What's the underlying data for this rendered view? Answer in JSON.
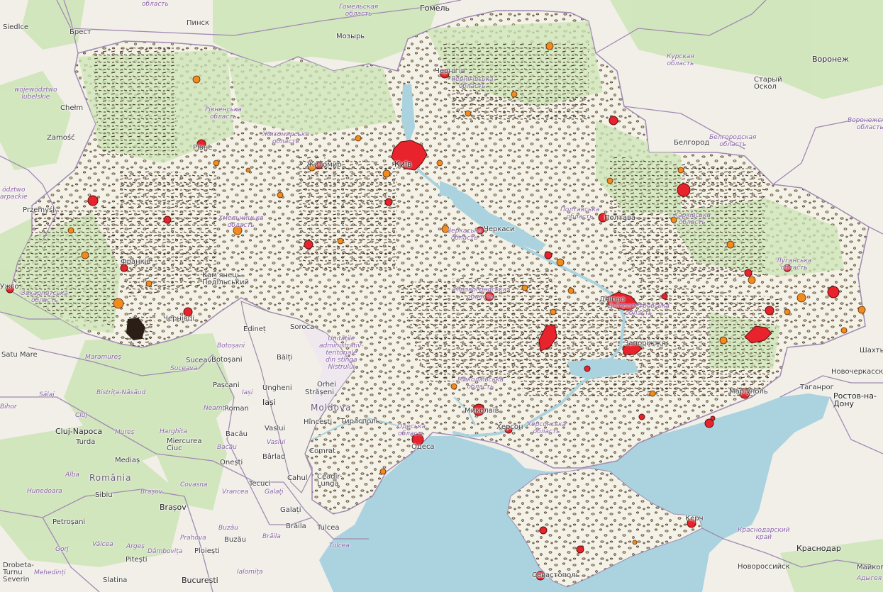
{
  "colors": {
    "land": "#f2efe9",
    "sea": "#aad3df",
    "forest": "#cde5b6",
    "ukraine_fill": "#f4f1e6",
    "urban_large": "#e8232b",
    "urban_medium": "#f28a1c",
    "settlement_outline": "#3a2a1e",
    "border": "#9b8aa6"
  },
  "labels": {
    "cities": [
      {
        "id": "gomel",
        "text": "Гомель"
      },
      {
        "id": "pinsk",
        "text": "Пинск"
      },
      {
        "id": "mozyr",
        "text": "Мозырь"
      },
      {
        "id": "brest",
        "text": "Брест"
      },
      {
        "id": "siedlce",
        "text": "Siedlce"
      },
      {
        "id": "chelm",
        "text": "Chełm"
      },
      {
        "id": "zamosc",
        "text": "Zamość"
      },
      {
        "id": "przemysl",
        "text": "Przemyśl"
      },
      {
        "id": "voronezh",
        "text": "Воронеж"
      },
      {
        "id": "stary_oskol",
        "text": "Старый\nОскол"
      },
      {
        "id": "belgorod",
        "text": "Белгород"
      },
      {
        "id": "chernihiv",
        "text": "Чернігів"
      },
      {
        "id": "kyiv",
        "text": "Київ"
      },
      {
        "id": "zhytomyr",
        "text": "Житомир"
      },
      {
        "id": "rivne",
        "text": "Рівне"
      },
      {
        "id": "poltava",
        "text": "Полтава"
      },
      {
        "id": "cherkasy",
        "text": "Черкаси"
      },
      {
        "id": "kamianets",
        "text": "Кам'янець-\nПодільський"
      },
      {
        "id": "ivano",
        "text": "Франків"
      },
      {
        "id": "chernivtsi",
        "text": "Чернівці"
      },
      {
        "id": "uzhhorod",
        "text": "Ужго"
      },
      {
        "id": "zaporizhzhia",
        "text": "Запоріжжя"
      },
      {
        "id": "dnipro",
        "text": "Дніпро"
      },
      {
        "id": "mariupol",
        "text": "Маріуполь"
      },
      {
        "id": "shakhty",
        "text": "Шахты"
      },
      {
        "id": "novocherkassk",
        "text": "Новочеркасск"
      },
      {
        "id": "taganrog",
        "text": "Таганрог"
      },
      {
        "id": "rostov",
        "text": "Ростов-на-\nДону"
      },
      {
        "id": "mykolaiv",
        "text": "Миколаїв"
      },
      {
        "id": "kherson",
        "text": "Херсон"
      },
      {
        "id": "odesa",
        "text": "Одеса"
      },
      {
        "id": "tiraspol",
        "text": "Тирасполь"
      },
      {
        "id": "kerch",
        "text": "Керч"
      },
      {
        "id": "sevastopol",
        "text": "Севастополь"
      },
      {
        "id": "krasnodar",
        "text": "Краснодар"
      },
      {
        "id": "novorossiysk",
        "text": "Новороссийск"
      },
      {
        "id": "maikop",
        "text": "Майкоп"
      },
      {
        "id": "edinet",
        "text": "Edineț"
      },
      {
        "id": "soroca",
        "text": "Soroca"
      },
      {
        "id": "balti",
        "text": "Bălți"
      },
      {
        "id": "ungheni",
        "text": "Ungheni"
      },
      {
        "id": "orhei",
        "text": "Orhei"
      },
      {
        "id": "straseni",
        "text": "Strășeni"
      },
      {
        "id": "iasi",
        "text": "Iași"
      },
      {
        "id": "hincesti",
        "text": "Hîncești"
      },
      {
        "id": "comrat",
        "text": "Comrat"
      },
      {
        "id": "cahul",
        "text": "Cahul"
      },
      {
        "id": "ceadir",
        "text": "Ceadîr-\nLunga"
      },
      {
        "id": "galati",
        "text": "Galați"
      },
      {
        "id": "braila",
        "text": "Brăila"
      },
      {
        "id": "tulcea",
        "text": "Tulcea"
      },
      {
        "id": "suceava",
        "text": "Suceava"
      },
      {
        "id": "botosani",
        "text": "Botoșani"
      },
      {
        "id": "pascani",
        "text": "Pașcani"
      },
      {
        "id": "roman",
        "text": "Roman"
      },
      {
        "id": "bacau",
        "text": "Bacău"
      },
      {
        "id": "vaslui",
        "text": "Vaslui"
      },
      {
        "id": "onesti",
        "text": "Onești"
      },
      {
        "id": "barlad",
        "text": "Bârlad"
      },
      {
        "id": "tecuci",
        "text": "Tecuci"
      },
      {
        "id": "cluj",
        "text": "Cluj-Napoca"
      },
      {
        "id": "turda",
        "text": "Turda"
      },
      {
        "id": "medias",
        "text": "Mediaș"
      },
      {
        "id": "sibiu",
        "text": "Sibiu"
      },
      {
        "id": "brasov",
        "text": "Brașov"
      },
      {
        "id": "miercurea",
        "text": "Miercurea\nCiuc"
      },
      {
        "id": "petrosani",
        "text": "Petroșani"
      },
      {
        "id": "pitesti",
        "text": "Pitești"
      },
      {
        "id": "ploiesti",
        "text": "Ploiești"
      },
      {
        "id": "buzau",
        "text": "Buzău"
      },
      {
        "id": "bucuresti",
        "text": "București"
      },
      {
        "id": "slatina",
        "text": "Slatina"
      },
      {
        "id": "drobeta",
        "text": "Drobeta-\nTurnu\nSeverin"
      },
      {
        "id": "satu_mare",
        "text": "Satu Mare"
      }
    ],
    "regions": [
      {
        "id": "gomel_obl",
        "text": "Гомельская\nобласть"
      },
      {
        "id": "brest_obl",
        "text": "область"
      },
      {
        "id": "kursk_obl",
        "text": "Курская\nобласть"
      },
      {
        "id": "belgorod_obl",
        "text": "Белгородская\nобласть"
      },
      {
        "id": "voronezh_obl",
        "text": "Воронежская\nобласть"
      },
      {
        "id": "lubelskie",
        "text": "województwo\nlubelskie"
      },
      {
        "id": "podkarpackie",
        "text": "ództwo\narpackie"
      },
      {
        "id": "rivne_obl",
        "text": "Рівненська\nобласть"
      },
      {
        "id": "zhytomyr_obl",
        "text": "Житомирська\nобласть"
      },
      {
        "id": "chernihiv_obl",
        "text": "Чернігівська\nобласть"
      },
      {
        "id": "poltava_obl",
        "text": "Полтавська\nобласть"
      },
      {
        "id": "cherkasy_obl",
        "text": "Черкаська\nобласть"
      },
      {
        "id": "khmelnytskyi_obl",
        "text": "Хмельницька\nобласть"
      },
      {
        "id": "kharkiv_obl",
        "text": "Харківська\nобласть"
      },
      {
        "id": "luhansk_obl",
        "text": "Луганська\nобласть"
      },
      {
        "id": "kirovohrad_obl",
        "text": "Кіровоградська\nобласть"
      },
      {
        "id": "dnipro_obl",
        "text": "Дніпропетровська\nобласть"
      },
      {
        "id": "mykolaiv_obl",
        "text": "Миколаївська\nобласть"
      },
      {
        "id": "odesa_obl",
        "text": "Одеська\nобласть"
      },
      {
        "id": "kherson_obl",
        "text": "Херсонська\nобласть"
      },
      {
        "id": "zakarpattia_obl",
        "text": "Закарпатська\nобласть"
      },
      {
        "id": "transnistria",
        "text": "Unitățile\nadministrativ-\nteritoriale\ndin stînga\nNistrului"
      },
      {
        "id": "krasnodar_krai",
        "text": "Краснодарский\nкрай"
      },
      {
        "id": "adygea",
        "text": "Адыгея"
      },
      {
        "id": "maramures",
        "text": "Maramureș"
      },
      {
        "id": "botosani_j",
        "text": "Botoșani"
      },
      {
        "id": "suceava_j",
        "text": "Suceava"
      },
      {
        "id": "salaj",
        "text": "Sălaj"
      },
      {
        "id": "bistrita",
        "text": "Bistrița-Năsăud"
      },
      {
        "id": "bihor",
        "text": "Bihor"
      },
      {
        "id": "cluj_j",
        "text": "Cluj"
      },
      {
        "id": "mures",
        "text": "Mureș"
      },
      {
        "id": "neamt",
        "text": "Neamț"
      },
      {
        "id": "iasi_j",
        "text": "Iași"
      },
      {
        "id": "harghita",
        "text": "Harghita"
      },
      {
        "id": "bacau_j",
        "text": "Bacău"
      },
      {
        "id": "vaslui_j",
        "text": "Vaslui"
      },
      {
        "id": "alba",
        "text": "Alba"
      },
      {
        "id": "covasna",
        "text": "Covasna"
      },
      {
        "id": "vrancea",
        "text": "Vrancea"
      },
      {
        "id": "galati_j",
        "text": "Galați"
      },
      {
        "id": "hunedoara",
        "text": "Hunedoara"
      },
      {
        "id": "brasov_j",
        "text": "Brașov"
      },
      {
        "id": "buzau_j",
        "text": "Buzău"
      },
      {
        "id": "braila_j",
        "text": "Brăila"
      },
      {
        "id": "tulcea_j",
        "text": "Tulcea"
      },
      {
        "id": "gorj",
        "text": "Gorj"
      },
      {
        "id": "valcea",
        "text": "Vâlcea"
      },
      {
        "id": "arges",
        "text": "Argeș"
      },
      {
        "id": "dambovita",
        "text": "Dâmbovița"
      },
      {
        "id": "prahova",
        "text": "Prahova"
      },
      {
        "id": "ialomita",
        "text": "Ialomița"
      },
      {
        "id": "mehedinti",
        "text": "Mehedinți"
      }
    ],
    "countries": [
      {
        "id": "moldova",
        "text": "Moldova"
      },
      {
        "id": "romania",
        "text": "România"
      }
    ]
  }
}
